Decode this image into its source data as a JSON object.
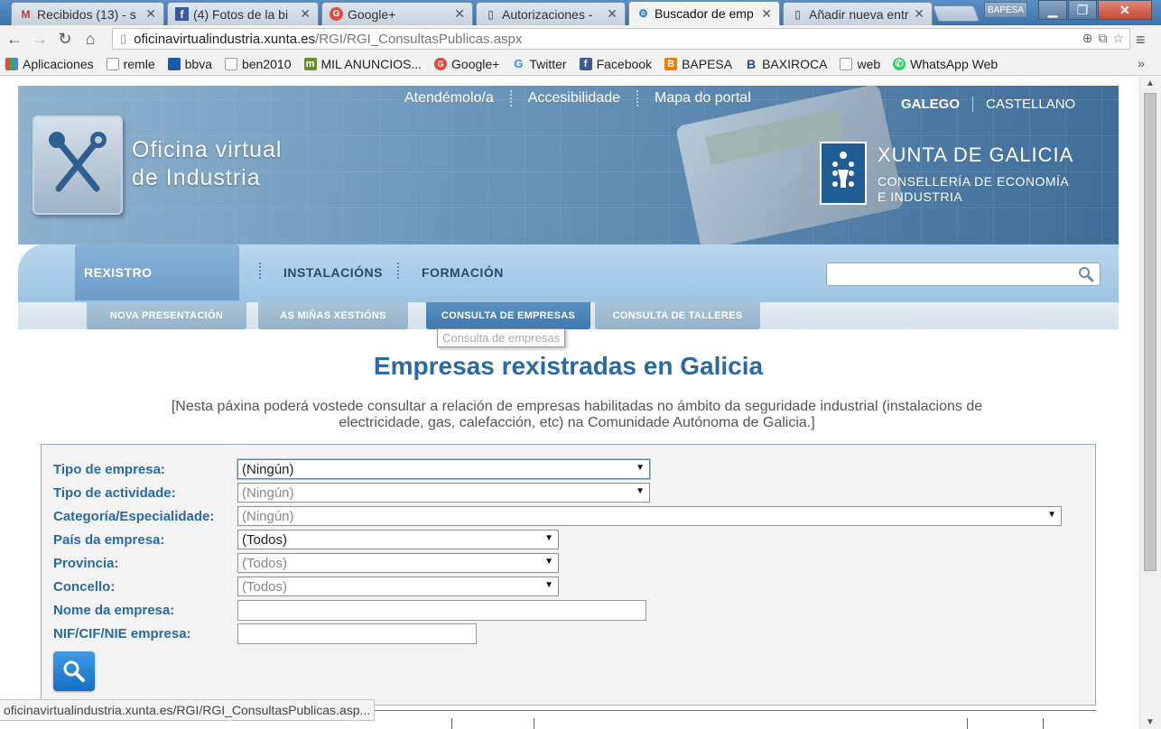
{
  "browser": {
    "tabs": [
      {
        "title": "Recibidos (13) - s",
        "favicon": "gmail-icon",
        "active": false
      },
      {
        "title": "(4) Fotos de la bi",
        "favicon": "facebook-icon",
        "active": false
      },
      {
        "title": "Google+",
        "favicon": "google-plus-icon",
        "active": false
      },
      {
        "title": "Autorizaciones - ",
        "favicon": "page-icon",
        "active": false
      },
      {
        "title": "Buscador de emp",
        "favicon": "xunta-icon",
        "active": true
      },
      {
        "title": "Añadir nueva entr",
        "favicon": "page-icon",
        "active": false
      }
    ],
    "profile_label": "BAPESA",
    "url_domain": "oficinavirtualindustria.xunta.es",
    "url_path": "/RGI/RGI_ConsultasPublicas.aspx",
    "bookmarks": [
      {
        "label": "Aplicaciones",
        "icon": "apps-icon",
        "color": "#e04a3a"
      },
      {
        "label": "remle",
        "icon": "page-icon",
        "color": "#999999"
      },
      {
        "label": "bbva",
        "icon": "bbva-icon",
        "color": "#1a5aa8"
      },
      {
        "label": "ben2010",
        "icon": "page-icon",
        "color": "#999999"
      },
      {
        "label": "MIL ANUNCIOS...",
        "icon": "milanuncios-icon",
        "color": "#6b8e23"
      },
      {
        "label": "Google+",
        "icon": "google-plus-icon",
        "color": "#dd4b39"
      },
      {
        "label": "Twitter",
        "icon": "google-icon",
        "color": "#4285f4"
      },
      {
        "label": "Facebook",
        "icon": "facebook-icon",
        "color": "#3b5998"
      },
      {
        "label": "BAPESA",
        "icon": "blogger-icon",
        "color": "#f57d00"
      },
      {
        "label": "BAXIROCA",
        "icon": "b-icon",
        "color": "#2b4f7a"
      },
      {
        "label": "web",
        "icon": "page-icon",
        "color": "#999999"
      },
      {
        "label": "WhatsApp Web",
        "icon": "whatsapp-icon",
        "color": "#25d366"
      }
    ],
    "status_url": "oficinavirtualindustria.xunta.es/RGI/RGI_ConsultasPublicas.asp..."
  },
  "header": {
    "site_title_line1": "Oficina virtual",
    "site_title_line2": "de Industria",
    "top_links": [
      "Atendémolo/a",
      "Accesibilidade",
      "Mapa do portal"
    ],
    "languages": [
      {
        "label": "GALEGO",
        "selected": true
      },
      {
        "label": "CASTELLANO",
        "selected": false
      }
    ],
    "xunta_name": "XUNTA DE GALICIA",
    "xunta_dept_line1": "CONSELLERÍA DE ECONOMÍA",
    "xunta_dept_line2": "E INDUSTRIA"
  },
  "main_nav": {
    "items": [
      {
        "label": "REXISTRO",
        "active": true
      },
      {
        "label": "INSTALACIÓNS",
        "active": false
      },
      {
        "label": "FORMACIÓN",
        "active": false
      }
    ]
  },
  "sub_nav": {
    "items": [
      {
        "label": "NOVA PRESENTACIÓN",
        "active": false
      },
      {
        "label": "AS MIÑAS XESTIÓNS",
        "active": false
      },
      {
        "label": "CONSULTA DE EMPRESAS",
        "active": true
      },
      {
        "label": "CONSULTA DE TALLERES",
        "active": false
      }
    ],
    "tooltip": "Consulta de empresas"
  },
  "content": {
    "title": "Empresas rexistradas en Galicia",
    "description": "[Nesta páxina poderá vostede consultar a relación de empresas habilitadas no ámbito da seguridade industrial (instalacions de electricidade, gas, calefacción, etc) na Comunidade Autónoma de Galicia.]"
  },
  "form": {
    "fields": [
      {
        "label": "Tipo de empresa:",
        "value": "(Ningún)",
        "type": "select",
        "enabled": true
      },
      {
        "label": "Tipo de actividade:",
        "value": "(Ningún)",
        "type": "select",
        "enabled": false
      },
      {
        "label": "Categoría/Especialidade:",
        "value": "(Ningún)",
        "type": "select",
        "enabled": false
      },
      {
        "label": "País da empresa:",
        "value": "(Todos)",
        "type": "select",
        "enabled": true
      },
      {
        "label": "Provincia:",
        "value": "(Todos)",
        "type": "select",
        "enabled": false
      },
      {
        "label": "Concello:",
        "value": "(Todos)",
        "type": "select",
        "enabled": false
      },
      {
        "label": "Nome da empresa:",
        "value": "",
        "type": "text",
        "enabled": true
      },
      {
        "label": "NIF/CIF/NIE empresa:",
        "value": "",
        "type": "text",
        "enabled": true
      }
    ],
    "search_icon": "search-icon"
  },
  "colors": {
    "accent": "#2a6aa4",
    "nav_bg": "#b9d7ec",
    "subtab_active": "#4a84b8"
  }
}
